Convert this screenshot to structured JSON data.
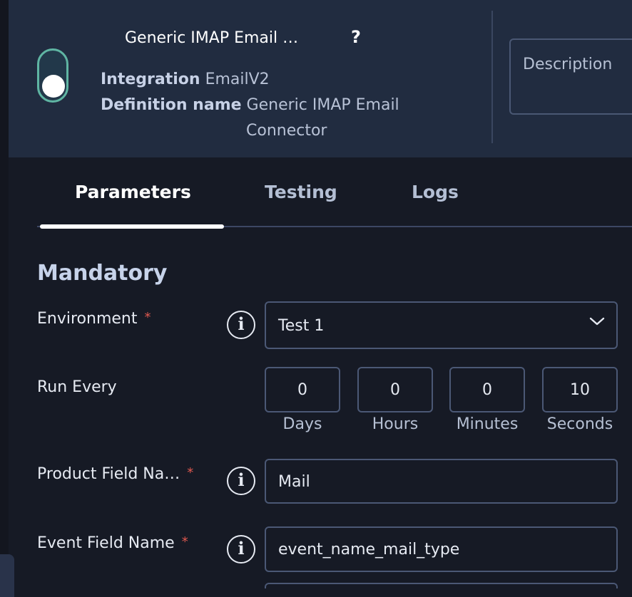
{
  "header": {
    "title": "Generic IMAP Email …",
    "help": "?",
    "integration_label": "Integration",
    "integration_value": "EmailV2",
    "definition_label": "Definition name",
    "definition_value_line1": "Generic IMAP Email",
    "definition_value_line2": "Connector",
    "description_placeholder": "Description",
    "enabled": true
  },
  "tabs": [
    {
      "label": "Parameters",
      "active": true
    },
    {
      "label": "Testing",
      "active": false
    },
    {
      "label": "Logs",
      "active": false
    }
  ],
  "section_title": "Mandatory",
  "fields": {
    "environment": {
      "label": "Environment",
      "required_mark": "*",
      "value": "Test 1"
    },
    "run_every": {
      "label": "Run Every",
      "days": "0",
      "hours": "0",
      "minutes": "0",
      "seconds": "10",
      "days_label": "Days",
      "hours_label": "Hours",
      "minutes_label": "Minutes",
      "seconds_label": "Seconds"
    },
    "product_field_name": {
      "label": "Product Field Na…",
      "required_mark": "*",
      "value": "Mail"
    },
    "event_field_name": {
      "label": "Event Field Name",
      "required_mark": "*",
      "value": "event_name_mail_type"
    }
  },
  "icons": {
    "info": "i"
  },
  "colors": {
    "header_bg": "#212c40",
    "page_bg": "#161a25",
    "accent_toggle": "#5fb5a3",
    "required": "#e0584f"
  }
}
